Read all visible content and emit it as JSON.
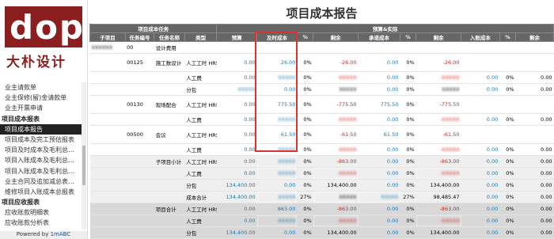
{
  "brand": {
    "letters": "dop",
    "name": "大朴设计",
    "color": "#8b1e1e"
  },
  "sidebar": {
    "items": [
      {
        "label": "业主请款单",
        "type": "item"
      },
      {
        "label": "业主保修(留)金请款单",
        "type": "item"
      },
      {
        "label": "业主开票申请",
        "type": "item"
      },
      {
        "label": "项目成本报表",
        "type": "section"
      },
      {
        "label": "项目成本报告",
        "type": "active"
      },
      {
        "label": "项目成本及完工预估报表",
        "type": "item"
      },
      {
        "label": "项目及时成本及毛利总…",
        "type": "item"
      },
      {
        "label": "项目入账成本及毛利总…",
        "type": "item"
      },
      {
        "label": "项目入账成本及毛利总…",
        "type": "item"
      },
      {
        "label": "业主合同及追加减总表…",
        "type": "item"
      },
      {
        "label": "维修项目入账成本总报表",
        "type": "item"
      },
      {
        "label": "项目应收报表",
        "type": "section"
      },
      {
        "label": "应收账款明细表",
        "type": "item"
      },
      {
        "label": "应收账款分析表",
        "type": "item"
      }
    ]
  },
  "footer": {
    "prefix": "Powered by ",
    "link": "1mABC"
  },
  "report": {
    "title": "项目成本报告",
    "group_headers": {
      "task": "项目成本任务",
      "budget": "预算&实际"
    },
    "columns": [
      "子项目",
      "任务编号",
      "任务名称",
      "类型",
      "预算",
      "及时成本",
      "%",
      "剩余",
      "承诺成本",
      "%",
      "剩余",
      "入账成本",
      "%",
      "剩余"
    ],
    "rows": [
      {
        "cls": "",
        "c": [
          "XXXXXX",
          "00",
          "设计费用",
          "",
          "",
          "",
          "",
          "",
          "",
          "",
          "",
          "",
          "",
          ""
        ]
      },
      {
        "cls": "tall",
        "c": [
          "",
          "00125",
          "施工数设计",
          "人工工时 HRS",
          "0.00",
          "26.00",
          "0%",
          "-26.00",
          "0.00",
          "0%",
          "-26.00",
          "",
          "",
          ""
        ]
      },
      {
        "cls": "",
        "c": [
          "",
          "",
          "",
          "人工费",
          "0.00",
          "XXXXX",
          "0%",
          "-XXXXX",
          "0.00",
          "0%",
          "-XXXXX",
          "0.00",
          "0%",
          "0.00"
        ]
      },
      {
        "cls": "",
        "c": [
          "",
          "",
          "",
          "分包",
          "XXXXX",
          "0.00",
          "0%",
          "XXXXX",
          "0.00",
          "0%",
          "XXXXX",
          "0.00",
          "0%",
          "0.00"
        ]
      },
      {
        "cls": "tall",
        "c": [
          "",
          "00130",
          "现场配合",
          "人工工时 HRS",
          "0.00",
          "775.50",
          "0%",
          "-775.50",
          "775.50",
          "0%",
          "-775.50",
          "",
          "",
          ""
        ]
      },
      {
        "cls": "",
        "c": [
          "",
          "",
          "",
          "人工费",
          "0.00",
          "XXXXX",
          "0%",
          "-XXXXX",
          "0.00",
          "0%",
          "-XXXXX",
          "0.00",
          "0%",
          "0.00"
        ]
      },
      {
        "cls": "tall",
        "c": [
          "",
          "00500",
          "会议",
          "人工工时 HRS",
          "0.00",
          "61.50",
          "0%",
          "-61.50",
          "61.50",
          "0%",
          "-61.50",
          "",
          "",
          ""
        ]
      },
      {
        "cls": "",
        "c": [
          "",
          "",
          "",
          "人工费",
          "0.00",
          "XXXXX",
          "0%",
          "-XXXXX",
          "0.00",
          "0%",
          "-XXXXX",
          "0.00",
          "0%",
          "0.00"
        ]
      },
      {
        "cls": "light",
        "c": [
          "",
          "",
          "子项目小计",
          "人工工时 HRS",
          "0.00",
          "XXXXX",
          "0%",
          "-863.00",
          "0.00",
          "0%",
          "-863.00",
          "0.00",
          "0%",
          "0.00"
        ]
      },
      {
        "cls": "light",
        "c": [
          "",
          "",
          "",
          "人工费",
          "0.00",
          "XXXXX",
          "0%",
          "-XXXXX",
          "0.00",
          "0%",
          "-XXXXX",
          "0.00",
          "0%",
          "0.00"
        ]
      },
      {
        "cls": "light",
        "c": [
          "",
          "",
          "",
          "分包",
          "134,400.00",
          "0.00",
          "0%",
          "134,400.00",
          "0.00",
          "0%",
          "134,400.00",
          "0.00",
          "0%",
          "0.00"
        ]
      },
      {
        "cls": "light",
        "c": [
          "",
          "",
          "",
          "成本合计",
          "134,400.00",
          "XXXXX",
          "27%",
          "XXXXX",
          "XXXXX",
          "27%",
          "98,485.47",
          "0.00",
          "0%",
          "0.00"
        ]
      },
      {
        "cls": "grey",
        "c": [
          "",
          "",
          "项目合计",
          "人工工时 HRS",
          "0.00",
          "863.00",
          "0%",
          "-863.00",
          "0.00",
          "0%",
          "-863.00",
          "0.00",
          "0%",
          "0.00"
        ]
      },
      {
        "cls": "grey",
        "c": [
          "",
          "",
          "",
          "人工费",
          "0.00",
          "XXXXX",
          "0%",
          "-XXXXX",
          "0.00",
          "0%",
          "-XXXXX",
          "0.00",
          "0%",
          "0.00"
        ]
      },
      {
        "cls": "grey",
        "c": [
          "",
          "",
          "",
          "分包",
          "134,400.00",
          "0.00",
          "0%",
          "134,400.00",
          "0.00",
          "0%",
          "134,400.00",
          "0.00",
          "0%",
          "0.00"
        ]
      }
    ]
  }
}
